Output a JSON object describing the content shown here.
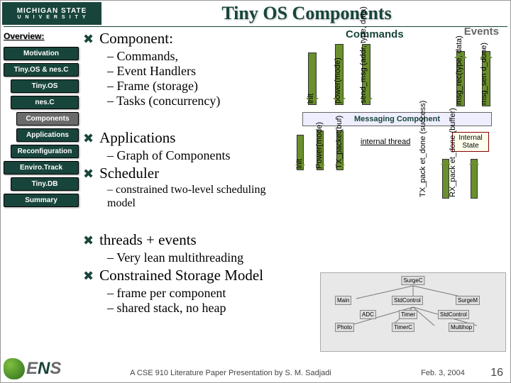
{
  "title": "Tiny OS Components",
  "logo": {
    "l1": "MICHIGAN STATE",
    "l2": "UNIVERSITY"
  },
  "sidebar": {
    "header": "Overview:",
    "items": [
      {
        "label": "Motivation",
        "lvl": 1
      },
      {
        "label": "Tiny.OS & nes.C",
        "lvl": 1
      },
      {
        "label": "Tiny.OS",
        "lvl": 2
      },
      {
        "label": "nes.C",
        "lvl": 2
      },
      {
        "label": "Components",
        "lvl": 3,
        "active": true
      },
      {
        "label": "Applications",
        "lvl": 3
      },
      {
        "label": "Reconfiguration",
        "lvl": 2
      },
      {
        "label": "Enviro.Track",
        "lvl": 1
      },
      {
        "label": "Tiny.DB",
        "lvl": 2
      },
      {
        "label": "Summary",
        "lvl": 1
      }
    ]
  },
  "outline": {
    "b1": "Component:",
    "b1subs": [
      "Commands,",
      "Event Handlers",
      "Frame (storage)",
      "Tasks (concurrency)"
    ],
    "b2": "Applications",
    "b2subs": [
      "Graph of Components"
    ],
    "b3": "Scheduler",
    "b3subs": [
      "constrained two-level scheduling model"
    ],
    "b4": "threads + events",
    "b4subs": [
      "Very lean multithreading"
    ],
    "b5": "Constrained Storage Model",
    "b5subs": [
      "frame per component",
      "shared stack, no heap"
    ]
  },
  "fig1": {
    "cmd_hdr": "Commands",
    "ev_hdr": "Events",
    "cmd_arrows": [
      "init",
      "power(mode)",
      "send_msg\n(addr,\ntype, data)"
    ],
    "ev_arrows": [
      "msg_rec(type, data)",
      "msg_sen\nd_done)"
    ],
    "box": "Messaging Component"
  },
  "fig2": {
    "dn": [
      "init",
      "Power(mode)",
      "TX_packet(buf)"
    ],
    "up": [
      "TX_pack\net_done\n(success)",
      "RX_pack\net_done\n(buffer)"
    ],
    "thread": "internal thread",
    "state": "Internal\nState"
  },
  "surgec": {
    "top": "SurgeC",
    "mid": [
      "Main",
      "StdControl",
      "SurgeM"
    ],
    "bot": [
      "Photo",
      "TimerC",
      "Multihop"
    ],
    "extra": [
      "ADC",
      "Timer",
      "StdControl"
    ]
  },
  "footer": {
    "left": "A CSE 910 Literature Paper Presentation by S. M. Sadjadi",
    "right": "Feb. 3, 2004",
    "page": "16"
  },
  "sens": "ENS"
}
